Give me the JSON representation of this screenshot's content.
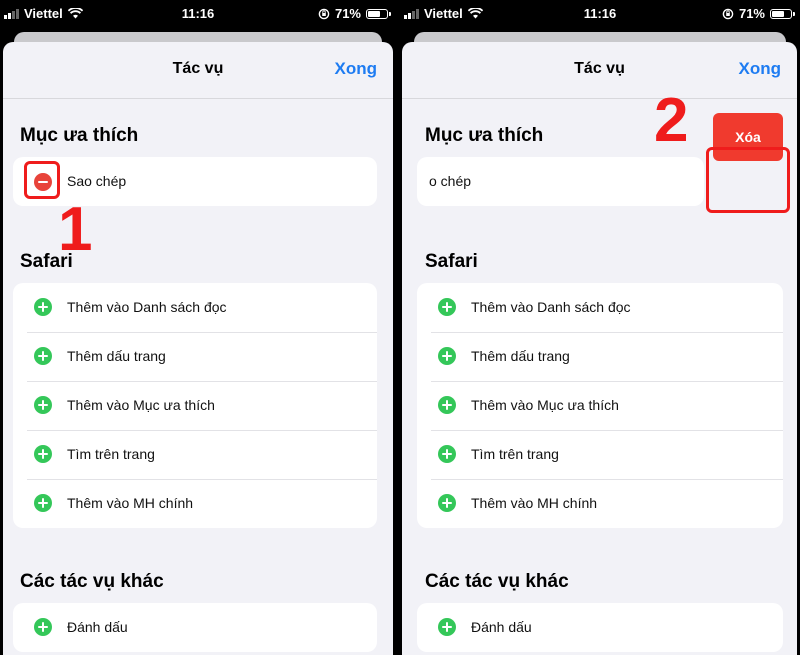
{
  "status_bar": {
    "carrier": "Viettel",
    "time": "11:16",
    "battery": "71%"
  },
  "nav": {
    "title": "Tác vụ",
    "done": "Xong"
  },
  "favorites": {
    "header": "Mục ưa thích",
    "item": "Sao chép",
    "item_partial": "o chép"
  },
  "safari": {
    "header": "Safari",
    "items": [
      "Thêm vào Danh sách đọc",
      "Thêm dấu trang",
      "Thêm vào Mục ưa thích",
      "Tìm trên trang",
      "Thêm vào MH chính"
    ]
  },
  "other": {
    "header": "Các tác vụ khác",
    "items": [
      "Đánh dấu"
    ]
  },
  "delete_label": "Xóa",
  "annotations": [
    "1",
    "2"
  ],
  "colors": {
    "accent": "#1e7cf2",
    "add": "#34c759",
    "remove": "#e8433a",
    "delete": "#f03a2e",
    "annotation": "#ef1c1c"
  }
}
